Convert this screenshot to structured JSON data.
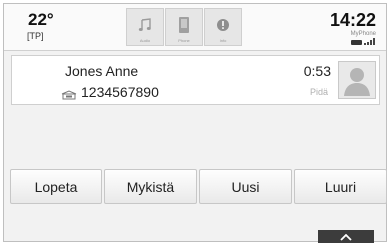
{
  "status": {
    "temperature": "22°",
    "tp_label": "[TP]",
    "time": "14:22",
    "phone_name": "MyPhone",
    "tabs": [
      {
        "icon": "music-icon",
        "label": "Audio"
      },
      {
        "icon": "phone-icon",
        "label": "Phone"
      },
      {
        "icon": "info-icon",
        "label": "Info"
      }
    ]
  },
  "call": {
    "name": "Jones Anne",
    "number": "1234567890",
    "duration": "0:53",
    "hold_label": "Pidä"
  },
  "actions": {
    "end": "Lopeta",
    "mute": "Mykistä",
    "new": "Uusi",
    "handset": "Luuri"
  },
  "colors": {
    "background": "#f2f2f2",
    "handle": "#3c3c3c"
  }
}
